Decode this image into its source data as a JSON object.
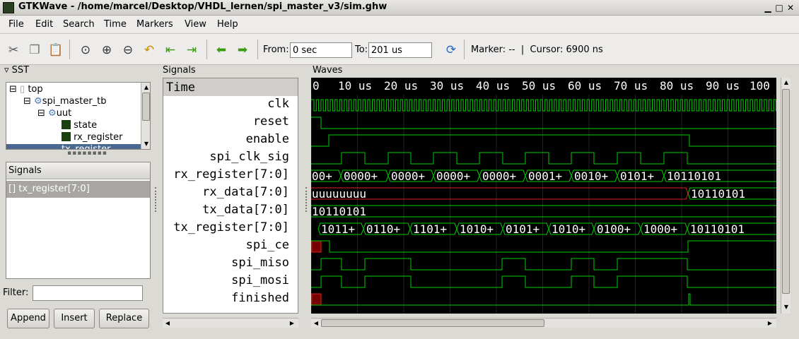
{
  "window": {
    "title": "GTKWave - /home/marcel/Desktop/VHDL_lernen/spi_master_v3/sim.ghw"
  },
  "menu": [
    "File",
    "Edit",
    "Search",
    "Time",
    "Markers",
    "View",
    "Help"
  ],
  "toolbar": {
    "from_label": "From:",
    "from_value": "0 sec",
    "to_label": "To:",
    "to_value": "201 us",
    "status": "Marker: --  |  Cursor: 6900 ns"
  },
  "sst": {
    "label": "SST",
    "tree": [
      {
        "label": "top",
        "depth": 0
      },
      {
        "label": "spi_master_tb",
        "depth": 1
      },
      {
        "label": "uut",
        "depth": 2
      },
      {
        "label": "state",
        "depth": 3
      },
      {
        "label": "rx_register",
        "depth": 3
      },
      {
        "label": "tx_register",
        "depth": 3
      }
    ]
  },
  "signals_panel": {
    "label": "Signals",
    "items": [
      "[] tx_register[7:0]"
    ]
  },
  "filter": {
    "label": "Filter:",
    "value": ""
  },
  "buttons": {
    "append": "Append",
    "insert": "Insert",
    "replace": "Replace"
  },
  "signal_names": {
    "label": "Signals",
    "header": "Time",
    "rows": [
      "clk",
      "reset",
      "enable",
      "spi_clk_sig",
      "rx_register[7:0]",
      "rx_data[7:0]",
      "tx_data[7:0]",
      "tx_register[7:0]",
      "spi_ce",
      "spi_miso",
      "spi_mosi",
      "finished"
    ]
  },
  "waves": {
    "label": "Waves",
    "time_labels": [
      "0",
      "10 us",
      "20 us",
      "30 us",
      "40 us",
      "50 us",
      "60 us",
      "70 us",
      "80 us",
      "90 us",
      "100"
    ],
    "rx_register_values": [
      "00+",
      "0000+",
      "0000+",
      "0000+",
      "0000+",
      "0001+",
      "0010+",
      "0101+",
      "10110101"
    ],
    "rx_data_values": [
      "uuuuuuuu",
      "10110101"
    ],
    "tx_data_values": [
      "10110101"
    ],
    "tx_register_values": [
      "1011+",
      "0110+",
      "1101+",
      "1010+",
      "0101+",
      "1010+",
      "0100+",
      "1000+",
      "10110101"
    ],
    "colors": {
      "background": "#000000",
      "trace": "#00d000",
      "text": "#ffffff",
      "undefined": "#e02020"
    }
  }
}
